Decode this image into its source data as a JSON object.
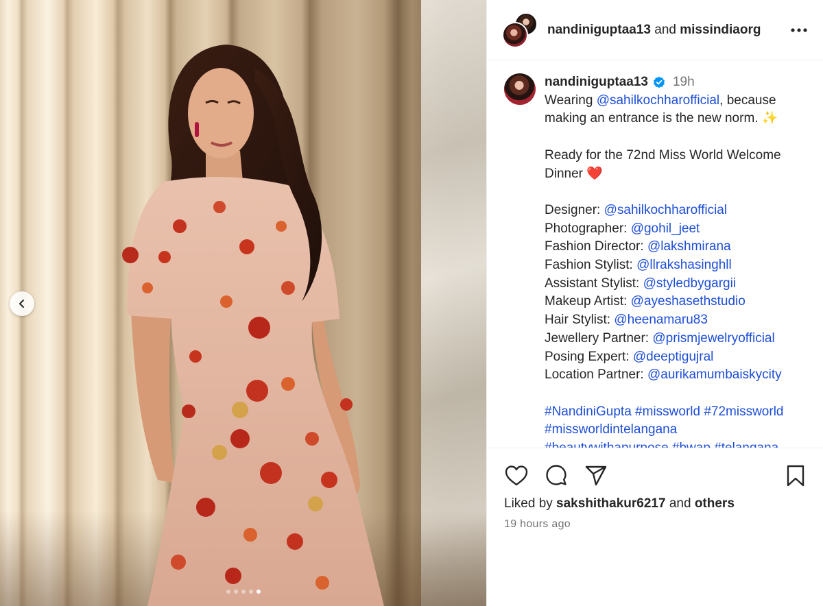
{
  "header": {
    "user": "nandiniguptaa13",
    "and": "and",
    "collaborator": "missindiaorg"
  },
  "caption": {
    "username": "nandiniguptaa13",
    "time": "19h",
    "line1_pre": "Wearing ",
    "line1_link": "@sahilkochharofficial",
    "line1_post": ", because",
    "line2": "making an entrance is the new norm. ✨",
    "line3": "Ready for the 72nd Miss World Welcome",
    "line4": "Dinner ❤️",
    "credits": [
      {
        "label": "Designer: ",
        "handle": "@sahilkochharofficial"
      },
      {
        "label": "Photographer: ",
        "handle": "@gohil_jeet"
      },
      {
        "label": "Fashion Director: ",
        "handle": "@lakshmirana"
      },
      {
        "label": "Fashion Stylist: ",
        "handle": "@llrakshasinghll"
      },
      {
        "label": "Assistant Stylist: ",
        "handle": "@styledbygargii"
      },
      {
        "label": "Makeup Artist: ",
        "handle": "@ayeshasethstudio"
      },
      {
        "label": "Hair Stylist: ",
        "handle": "@heenamaru83"
      },
      {
        "label": "Jewellery Partner: ",
        "handle": "@prismjewelryofficial"
      },
      {
        "label": "Posing Expert: ",
        "handle": "@deeptigujral"
      },
      {
        "label": "Location Partner: ",
        "handle": "@aurikamumbaiskycity"
      }
    ],
    "hashtags_line1": "#NandiniGupta #missworld #72missworld",
    "hashtags_line2": "#missworldintelangana",
    "hashtags_line3": "#beautywithapurpose #bwap #telangana"
  },
  "likes": {
    "prefix": "Liked by ",
    "user": "sakshithakur6217",
    "mid": " and ",
    "others": "others"
  },
  "timestamp": "19 hours ago",
  "carousel": {
    "count": 5,
    "active_index": 4
  },
  "colors": {
    "link": "#1d4ed8",
    "verified": "#0095f6",
    "heart": "#ed1c3a"
  },
  "icons": [
    "chevron-left-icon",
    "more-icon",
    "verified-icon",
    "heart-icon",
    "comment-icon",
    "share-icon",
    "bookmark-icon"
  ]
}
